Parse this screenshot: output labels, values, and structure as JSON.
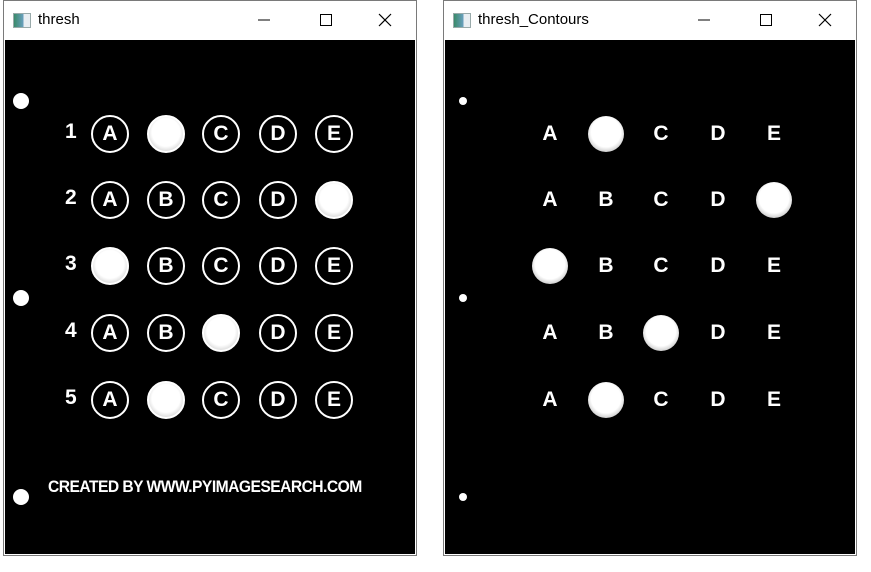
{
  "windows": [
    {
      "title": "thresh",
      "variant": "thresh"
    },
    {
      "title": "thresh_Contours",
      "variant": "contours"
    }
  ],
  "icons": {
    "minimize": "minimize-icon",
    "maximize": "maximize-icon",
    "close": "close-icon"
  },
  "sheet": {
    "options": [
      "A",
      "B",
      "C",
      "D",
      "E"
    ],
    "questions": [
      {
        "number": "1",
        "filled": 1
      },
      {
        "number": "2",
        "filled": 4
      },
      {
        "number": "3",
        "filled": 0
      },
      {
        "number": "4",
        "filled": 2
      },
      {
        "number": "5",
        "filled": 1
      }
    ],
    "credit": "CREATED BY WWW.PYIMAGESEARCH.COM"
  }
}
